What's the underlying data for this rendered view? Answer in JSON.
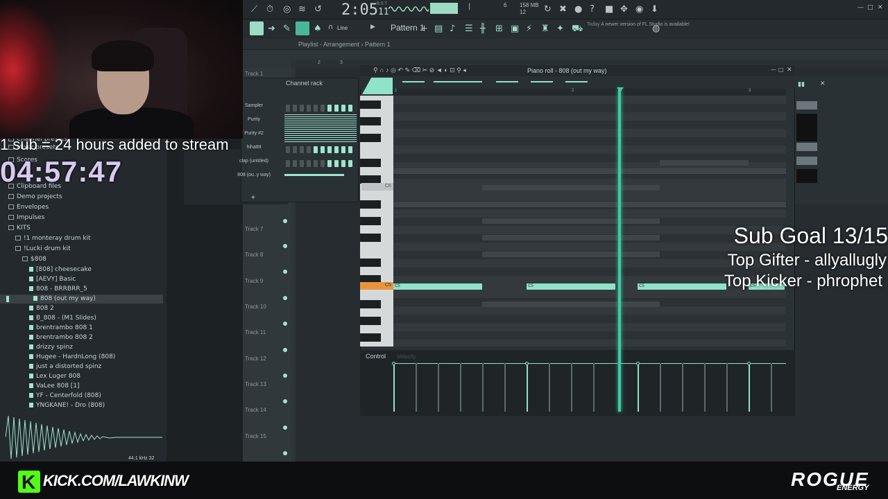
{
  "overlay": {
    "sub_rule": "1 sub = 24 hours added to stream",
    "timer": "04:57:47",
    "sub_goal": "Sub Goal 13/15",
    "top_gifter": "Top Gifter - allyallugly",
    "top_kicker": "Top Kicker - phrophet"
  },
  "toolbar": {
    "song_time": "2:05",
    "song_time_ticks": "11",
    "bst_label": "B:S:T",
    "cpu_value": "6",
    "mem_value": "158 MB",
    "poly_value": "12",
    "snap_mode": "Line",
    "pattern_name": "Pattern 1",
    "news_tag": "Today",
    "news_text": "A newer version of FL Studio is available!"
  },
  "playlist": {
    "breadcrumb": [
      "Playlist - Arrangement",
      "Pattern 1"
    ],
    "ruler": [
      "2",
      "3"
    ],
    "tracks": [
      "Track 1",
      "Track 7",
      "Track 8",
      "Track 9",
      "Track 10",
      "Track 11",
      "Track 12",
      "Track 13",
      "Track 14",
      "Track 15"
    ]
  },
  "channel_rack": {
    "title": "Channel rack",
    "channels": [
      "Sampler",
      "Purity",
      "Purity #2",
      "hihatttt",
      "clap (untitled)",
      "808 (ou..y way)"
    ]
  },
  "piano_roll": {
    "title": "Piano roll - 808 (out my way)",
    "ruler": [
      "1",
      "2",
      "3"
    ],
    "key_labels": {
      "c6": "C6",
      "c5": "C5"
    },
    "note_label": "C5",
    "control_label": "Control",
    "control_param": "Velocity"
  },
  "browser": {
    "items": [
      {
        "label": "Channel presets",
        "type": "folder"
      },
      {
        "label": "Mixer presets",
        "type": "folder"
      },
      {
        "label": "Scores",
        "type": "folder"
      },
      {
        "label": "Clipboard files",
        "type": "folder"
      },
      {
        "label": "Demo projects",
        "type": "folder"
      },
      {
        "label": "Envelopes",
        "type": "folder"
      },
      {
        "label": "Impulses",
        "type": "folder"
      },
      {
        "label": "KITS",
        "type": "folder"
      },
      {
        "label": "!1 monteray drum kit",
        "type": "folder"
      },
      {
        "label": "!Lucki drum kit",
        "type": "folder"
      },
      {
        "label": "$808",
        "type": "folder"
      },
      {
        "label": "[808] cheesecake",
        "type": "file"
      },
      {
        "label": "[AEVY] Basic",
        "type": "file"
      },
      {
        "label": "808 - BRRBRR_5",
        "type": "file"
      },
      {
        "label": "808 (out my way)",
        "type": "file"
      },
      {
        "label": "808 2",
        "type": "file"
      },
      {
        "label": "B_808 - (M1 Slides)",
        "type": "file"
      },
      {
        "label": "brentrambo 808 1",
        "type": "file"
      },
      {
        "label": "brentrambo 808 2",
        "type": "file"
      },
      {
        "label": "drizzy spinz",
        "type": "file"
      },
      {
        "label": "Hugee - HardnLong (808)",
        "type": "file"
      },
      {
        "label": "just a distorted spinz",
        "type": "file"
      },
      {
        "label": "Lex Luger 808",
        "type": "file"
      },
      {
        "label": "VaLee 808 [1]",
        "type": "file"
      },
      {
        "label": "YF - Centerfold (808)",
        "type": "file"
      },
      {
        "label": "YNGKANE! - Dro (808)",
        "type": "file"
      }
    ],
    "sample_rate": "44.1 kHz 32"
  },
  "branding": {
    "kick_url": "KICK.COM/LAWKINW",
    "kick_letter": "K",
    "sponsor": "ROGUE",
    "sponsor_sub": "ENERGY"
  },
  "colors": {
    "accent": "#8fe3c8",
    "playhead": "#3ec9a4",
    "kick_green": "#53fc18",
    "key_highlight": "#e8943e"
  }
}
